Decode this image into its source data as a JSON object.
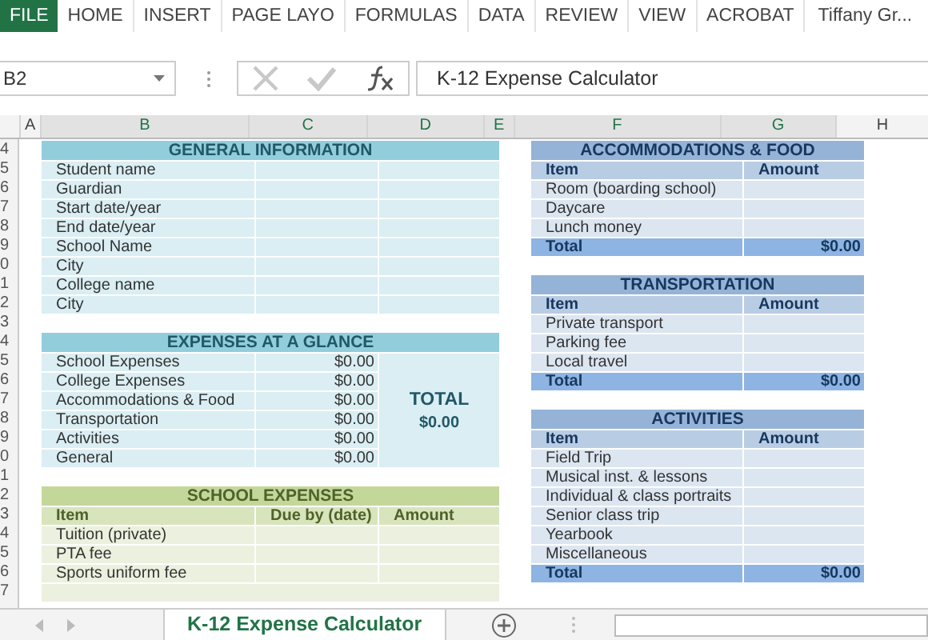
{
  "ribbon": {
    "tabs": [
      {
        "label": "FILE",
        "kind": "file"
      },
      {
        "label": "HOME",
        "kind": "tab"
      },
      {
        "label": "INSERT",
        "kind": "tab"
      },
      {
        "label": "PAGE LAYO",
        "kind": "tab"
      },
      {
        "label": "FORMULAS",
        "kind": "tab"
      },
      {
        "label": "DATA",
        "kind": "tab"
      },
      {
        "label": "REVIEW",
        "kind": "tab"
      },
      {
        "label": "VIEW",
        "kind": "tab"
      },
      {
        "label": "ACROBAT",
        "kind": "tab"
      }
    ],
    "user": "Tiffany Gr..."
  },
  "formula_bar": {
    "name_box": "B2",
    "formula": "K-12 Expense Calculator"
  },
  "columns": [
    "A",
    "B",
    "C",
    "D",
    "E",
    "F",
    "G",
    "H"
  ],
  "row_numbers": [
    "4",
    "5",
    "6",
    "7",
    "8",
    "9",
    "0",
    "1",
    "2",
    "3",
    "4",
    "5",
    "6",
    "7",
    "8",
    "9",
    "0",
    "1",
    "2",
    "3",
    "4",
    "5",
    "6",
    "7"
  ],
  "general_information": {
    "title": "GENERAL INFORMATION",
    "fields": [
      "Student name",
      "Guardian",
      "Start date/year",
      "End date/year",
      "School Name",
      "City",
      "College name",
      "City"
    ]
  },
  "expenses_at_a_glance": {
    "title": "EXPENSES AT A GLANCE",
    "rows": [
      {
        "label": "School Expenses",
        "amount": "$0.00"
      },
      {
        "label": "College Expenses",
        "amount": "$0.00"
      },
      {
        "label": "Accommodations & Food",
        "amount": "$0.00"
      },
      {
        "label": "Transportation",
        "amount": "$0.00"
      },
      {
        "label": "Activities",
        "amount": "$0.00"
      },
      {
        "label": "General",
        "amount": "$0.00"
      }
    ],
    "total_label": "TOTAL",
    "total_value": "$0.00"
  },
  "school_expenses": {
    "title": "SCHOOL EXPENSES",
    "columns": [
      "Item",
      "Due by (date)",
      "Amount"
    ],
    "rows": [
      "Tuition (private)",
      "PTA fee",
      "Sports uniform fee"
    ]
  },
  "accommodations_and_food": {
    "title": "ACCOMMODATIONS & FOOD",
    "columns": [
      "Item",
      "Amount"
    ],
    "rows": [
      "Room (boarding school)",
      "Daycare",
      "Lunch money"
    ],
    "total_label": "Total",
    "total": "$0.00"
  },
  "transportation": {
    "title": "TRANSPORTATION",
    "columns": [
      "Item",
      "Amount"
    ],
    "rows": [
      "Private transport",
      "Parking fee",
      "Local travel"
    ],
    "total_label": "Total",
    "total": "$0.00"
  },
  "activities": {
    "title": "ACTIVITIES",
    "columns": [
      "Item",
      "Amount"
    ],
    "rows": [
      "Field Trip",
      "Musical inst. & lessons",
      "Individual & class portraits",
      "Senior class trip",
      "Yearbook",
      "Miscellaneous"
    ],
    "total_label": "Total",
    "total": "$0.00"
  },
  "sheet_tabs": [
    {
      "label": "K-12 Expense Calculator",
      "selected": true
    }
  ]
}
